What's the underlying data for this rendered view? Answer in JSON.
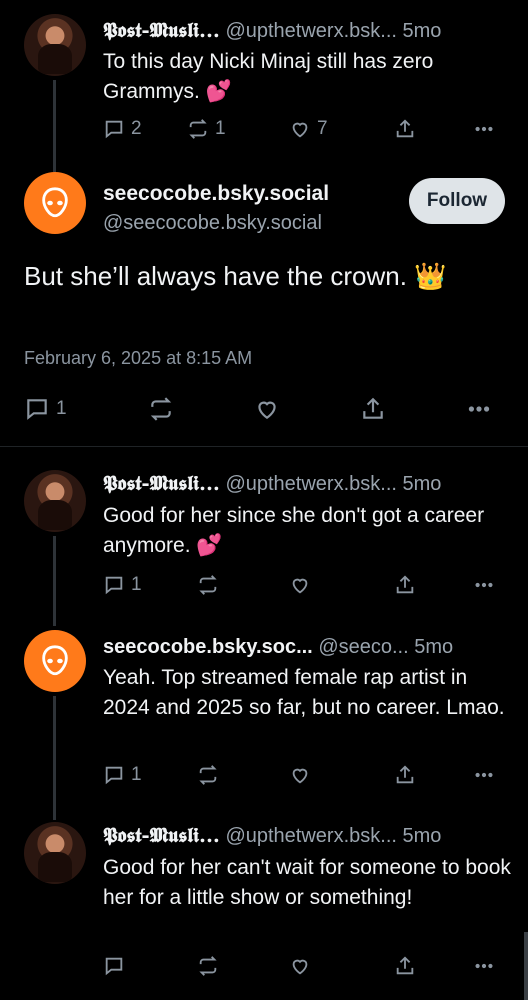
{
  "posts_top": {
    "name": "𝕻𝖔𝖘𝖙-𝕸𝖚𝖘𝖑𝖎...",
    "handle": "@upthetwerx.bsk...",
    "time": "5mo",
    "text": "To this day Nicki Minaj still has zero Grammys. 💕",
    "replies": "2",
    "reposts": "1",
    "likes": "7"
  },
  "main": {
    "name": "seecocobe.bsky.social",
    "handle": "@seecocobe.bsky.social",
    "follow_label": "Follow",
    "text": "But she’ll always have the crown. 👑",
    "date": "February 6, 2025 at 8:15 AM",
    "replies": "1"
  },
  "replies": [
    {
      "name": "𝕻𝖔𝖘𝖙-𝕸𝖚𝖘𝖑𝖎...",
      "handle": "@upthetwerx.bsk...",
      "time": "5mo",
      "text": "Good for her since she don't got a career anymore. 💕",
      "replies": "1",
      "reposts": "",
      "likes": ""
    },
    {
      "name": "seecocobe.bsky.soc...",
      "handle": "@seeco...",
      "time": "5mo",
      "text": "Yeah. Top streamed female rap artist in 2024 and 2025 so far, but no career. Lmao.",
      "replies": "1",
      "reposts": "",
      "likes": ""
    },
    {
      "name": "𝕻𝖔𝖘𝖙-𝕸𝖚𝖘𝖑𝖎...",
      "handle": "@upthetwerx.bsk...",
      "time": "5mo",
      "text": "Good for her can't wait for someone to book her for a little show or something!",
      "replies": "",
      "reposts": "",
      "likes": ""
    }
  ],
  "icons": {
    "reply": "speech-bubble-icon",
    "repost": "repost-arrows-icon",
    "like": "heart-icon",
    "share": "share-icon",
    "more": "ellipsis-icon",
    "avatar_alien": "alien-face-icon"
  },
  "colors": {
    "background": "#000000",
    "text": "#f1f3f5",
    "muted": "#8b95a0",
    "alien_avatar": "#ff7a1a",
    "follow_button": "#dfe4e8",
    "thread_line": "#2e3338"
  }
}
